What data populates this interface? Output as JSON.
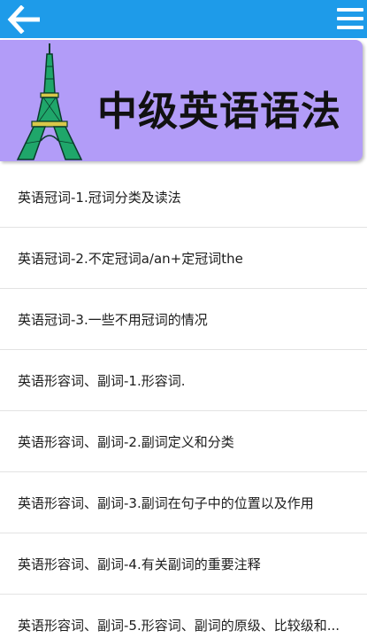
{
  "header": {
    "back_icon": "back-arrow-icon",
    "menu_icon": "hamburger-menu-icon",
    "color": "#1e9be9"
  },
  "banner": {
    "title": "中级英语语法",
    "image": "eiffel-tower-icon",
    "color": "#b29cf8"
  },
  "lessons": [
    {
      "label": "英语冠词-1.冠词分类及读法"
    },
    {
      "label": "英语冠词-2.不定冠词a/an+定冠词the"
    },
    {
      "label": "英语冠词-3.一些不用冠词的情况"
    },
    {
      "label": "英语形容词、副词-1.形容词."
    },
    {
      "label": "英语形容词、副词-2.副词定义和分类"
    },
    {
      "label": "英语形容词、副词-3.副词在句子中的位置以及作用"
    },
    {
      "label": "英语形容词、副词-4.有关副词的重要注释"
    },
    {
      "label": "英语形容词、副词-5.形容词、副词的原级、比较级和..."
    }
  ]
}
